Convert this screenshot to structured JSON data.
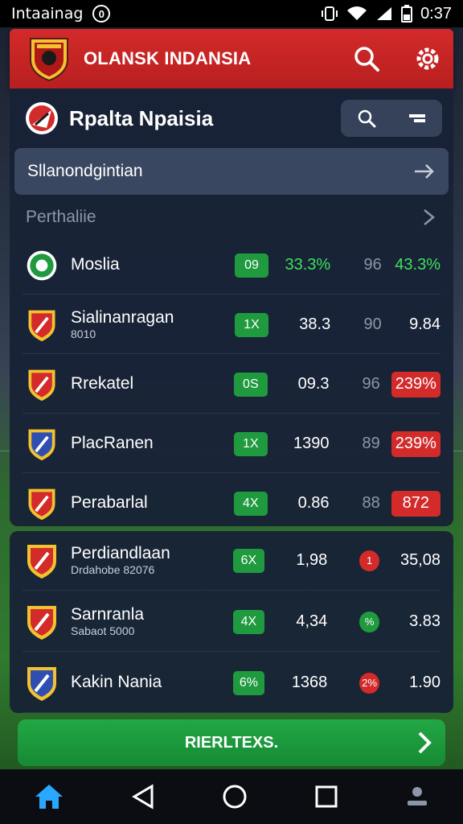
{
  "status_bar": {
    "carrier": "Intaainag",
    "notification_count": "0",
    "time": "0:37"
  },
  "header": {
    "title": "OLANSK INDANSIA",
    "icons": [
      "search-icon",
      "gear-icon"
    ]
  },
  "panel": {
    "heading": "Rpalta Npaisia",
    "subbar_label": "Sllanondgintian",
    "section_title": "Perthaliie"
  },
  "rows": [
    {
      "name": "Moslia",
      "sub": "",
      "badge": "09",
      "v1": "33.3%",
      "v2": "96",
      "v3": "43.3%",
      "v3_style": "green",
      "crest_color": "#1f9a3e"
    },
    {
      "name": "Sialinanragan",
      "sub": "8010",
      "badge": "1X",
      "v1": "38.3",
      "v2": "90",
      "v3": "9.84",
      "v3_style": "plain",
      "crest_color": "#d32a2a"
    },
    {
      "name": "Rrekatel",
      "sub": "",
      "badge": "0S",
      "v1": "09.3",
      "v2": "96",
      "v3": "239%",
      "v3_style": "pill",
      "crest_color": "#d32a2a"
    },
    {
      "name": "PlacRanen",
      "sub": "",
      "badge": "1X",
      "v1": "1390",
      "v2": "89",
      "v3": "239%",
      "v3_style": "pill",
      "crest_color": "#2f4fb0"
    },
    {
      "name": "Perabarlal",
      "sub": "",
      "badge": "4X",
      "v1": "0.86",
      "v2": "88",
      "v3": "872",
      "v3_style": "pill",
      "crest_color": "#d32a2a"
    }
  ],
  "rows2": [
    {
      "name": "Perdiandlaan",
      "sub": "Drdahobe 82076",
      "badge": "6X",
      "v1": "1,98",
      "dot": "1",
      "dot_color": "red",
      "v3": "35,08"
    },
    {
      "name": "Sarnranla",
      "sub": "Sabaot 5000",
      "badge": "4X",
      "v1": "4,34",
      "dot": "%",
      "dot_color": "green",
      "v3": "3.83"
    },
    {
      "name": "Kakin Nania",
      "sub": "",
      "badge": "6%",
      "v1": "1368",
      "dot": "2%",
      "dot_color": "red",
      "v3": "1.90"
    }
  ],
  "cta": {
    "label": "RIERLTEXS."
  },
  "nav": [
    "home-icon",
    "back-icon",
    "home-circle-icon",
    "recents-icon",
    "profile-icon"
  ],
  "colors": {
    "accent_red": "#d32a2a",
    "accent_green": "#1f9a3e",
    "panel_bg": "#182236"
  }
}
